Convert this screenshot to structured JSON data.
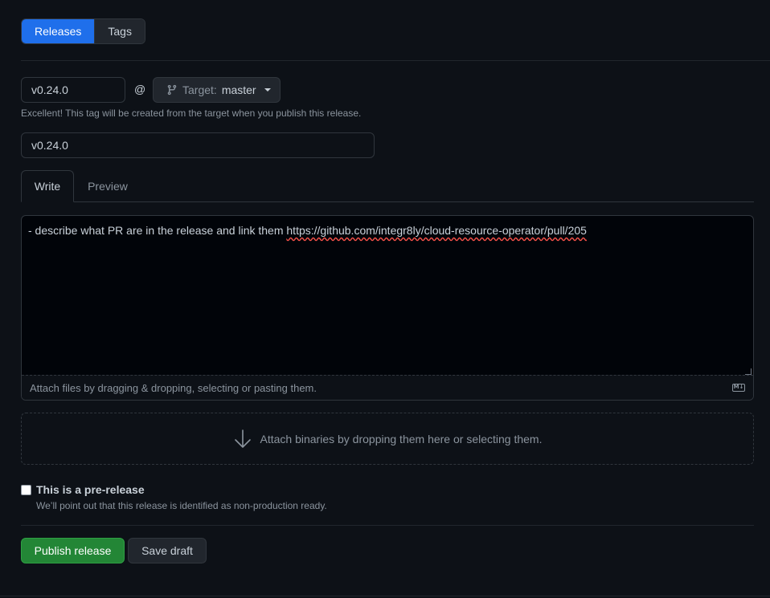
{
  "nav": {
    "tabs": [
      {
        "label": "Releases",
        "active": true
      },
      {
        "label": "Tags",
        "active": false
      }
    ]
  },
  "tag": {
    "value": "v0.24.0",
    "at_symbol": "@",
    "target_label": "Target:",
    "target_value": "master",
    "hint": "Excellent! This tag will be created from the target when you publish this release."
  },
  "release_title": {
    "value": "v0.24.0"
  },
  "editor": {
    "tabs": [
      {
        "label": "Write",
        "active": true
      },
      {
        "label": "Preview",
        "active": false
      }
    ],
    "body_prefix": "- describe what PR are in the release and link them ",
    "body_link": "https://github.com/integr8ly/cloud-resource-operator/pull/205",
    "footer": "Attach files by dragging & dropping, selecting or pasting them.",
    "markdown_icon": "markdown-icon"
  },
  "binaries": {
    "text": "Attach binaries by dropping them here or selecting them.",
    "icon": "arrow-down-icon"
  },
  "prerelease": {
    "title": "This is a pre-release",
    "description": "We’ll point out that this release is identified as non-production ready.",
    "checked": false
  },
  "actions": {
    "publish_label": "Publish release",
    "draft_label": "Save draft"
  },
  "colors": {
    "background": "#0d1117",
    "accent": "#1f6feb",
    "publish": "#238636",
    "border": "#30363d"
  }
}
